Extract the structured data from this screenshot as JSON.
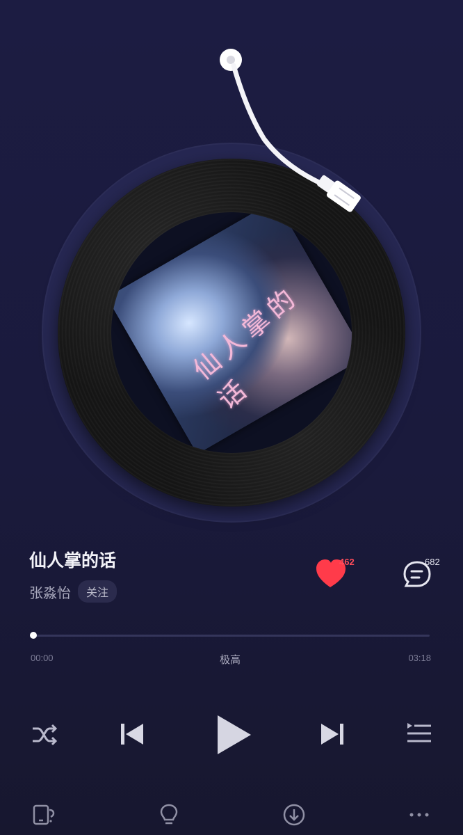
{
  "track": {
    "title": "仙人掌的话",
    "artist": "张淼怡",
    "follow_label": "关注",
    "cover_text": "仙人掌的话"
  },
  "stats": {
    "likes": "462",
    "comments": "682"
  },
  "progress": {
    "current": "00:00",
    "total": "03:18",
    "quality": "极高",
    "fraction": 0.0
  },
  "colors": {
    "background": "#1c1c42",
    "accent_like": "#ff3b4a",
    "text_primary": "#f2f2f7"
  },
  "icons": {
    "controls": [
      "shuffle-icon",
      "previous-icon",
      "play-icon",
      "next-icon",
      "playlist-icon"
    ],
    "bottom": [
      "device-icon",
      "lightbulb-icon",
      "download-icon",
      "more-icon"
    ]
  }
}
